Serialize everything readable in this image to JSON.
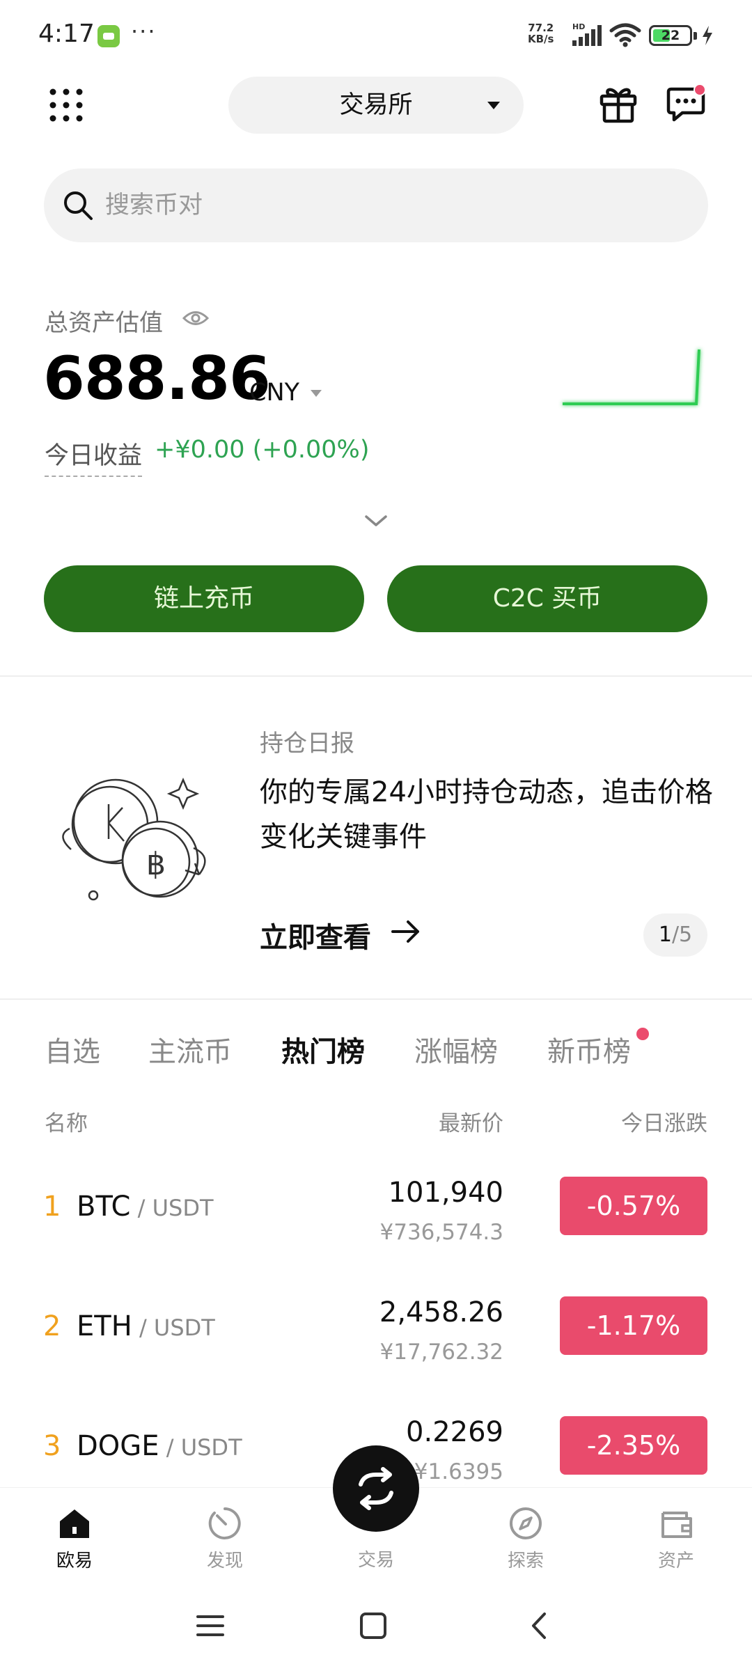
{
  "status_bar": {
    "time": "4:17",
    "dots": "···",
    "speed_value": "77.2",
    "speed_unit": "KB/s",
    "network": "HD",
    "battery": "22"
  },
  "header": {
    "exchange_label": "交易所"
  },
  "search": {
    "placeholder": "搜索币对"
  },
  "assets": {
    "label": "总资产估值",
    "value": "688.86",
    "currency": "CNY",
    "today_label": "今日收益",
    "today_value": "+¥0.00 (+0.00%)",
    "sparkline_color": "#2ecc52"
  },
  "actions": {
    "deposit": "链上充币",
    "c2c": "C2C 买币"
  },
  "banner": {
    "tag": "持仓日报",
    "text": "你的专属24小时持仓动态，追击价格变化关键事件",
    "cta": "立即查看",
    "page_current": "1",
    "page_sep_total": "/5"
  },
  "tabs": [
    "自选",
    "主流币",
    "热门榜",
    "涨幅榜",
    "新币榜"
  ],
  "active_tab": "热门榜",
  "columns": {
    "name": "名称",
    "price": "最新价",
    "change": "今日涨跌"
  },
  "rows": [
    {
      "rank": "1",
      "symbol": "BTC",
      "quote": " / USDT",
      "price": "101,940",
      "price_cny": "¥736,574.3",
      "change": "-0.57%"
    },
    {
      "rank": "2",
      "symbol": "ETH",
      "quote": " / USDT",
      "price": "2,458.26",
      "price_cny": "¥17,762.32",
      "change": "-1.17%"
    },
    {
      "rank": "3",
      "symbol": "DOGE",
      "quote": " / USDT",
      "price": "0.2269",
      "price_cny": "¥1.6395",
      "change": "-2.35%"
    }
  ],
  "bottom_nav": {
    "home": "欧易",
    "discover": "发现",
    "trade": "交易",
    "explore": "探索",
    "assets": "资产"
  },
  "colors": {
    "brand_green": "#27701a",
    "positive": "#2ea352",
    "negative": "#e94b6c",
    "rank": "#f0a11e"
  }
}
